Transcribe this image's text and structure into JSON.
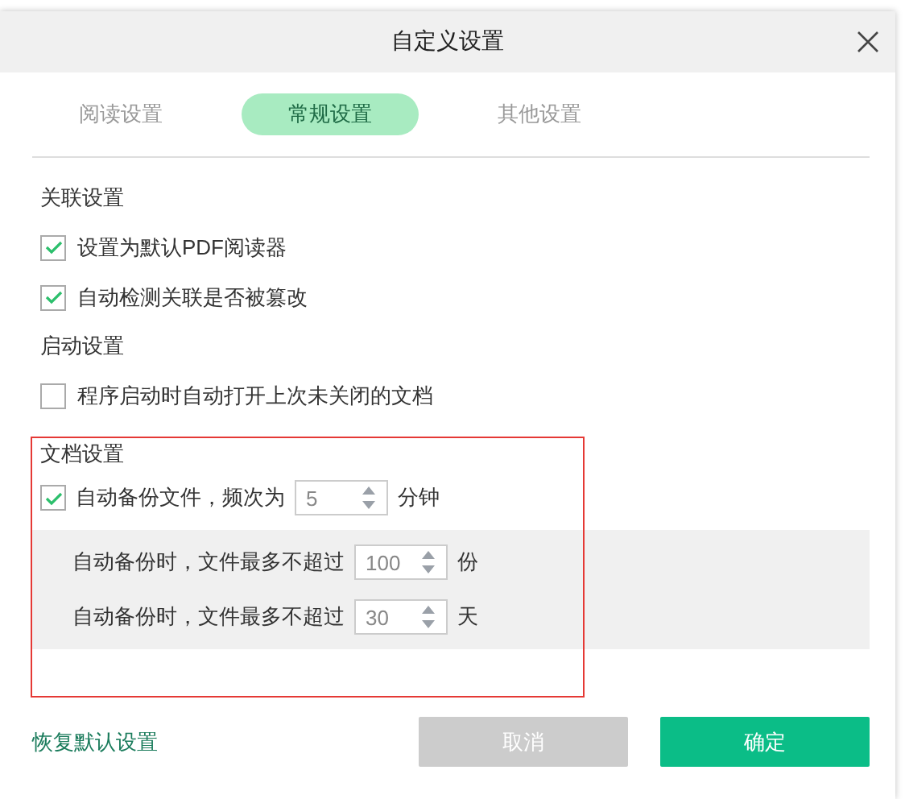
{
  "window": {
    "title": "自定义设置"
  },
  "tabs": [
    {
      "label": "阅读设置",
      "selected": false
    },
    {
      "label": "常规设置",
      "selected": true
    },
    {
      "label": "其他设置",
      "selected": false
    }
  ],
  "sections": [
    {
      "title": "关联设置",
      "options": [
        {
          "label": "设置为默认PDF阅读器",
          "checked": true
        },
        {
          "label": "自动检测关联是否被篡改",
          "checked": true
        }
      ]
    },
    {
      "title": "启动设置",
      "options": [
        {
          "label": "程序启动时自动打开上次未关闭的文档",
          "checked": false
        }
      ]
    }
  ],
  "document_settings": {
    "title": "文档设置",
    "highlighted": true,
    "auto_backup": {
      "label": "自动备份文件，频次为",
      "checked": true,
      "value": "5",
      "unit": "分钟"
    },
    "limits": [
      {
        "label": "自动备份时，文件最多不超过",
        "value": "100",
        "unit": "份"
      },
      {
        "label": "自动备份时，文件最多不超过",
        "value": "30",
        "unit": "天"
      }
    ]
  },
  "footer": {
    "reset_link": "恢复默认设置",
    "buttons": [
      {
        "label": "取消",
        "kind": "cancel"
      },
      {
        "label": "确定",
        "kind": "confirm"
      }
    ]
  }
}
